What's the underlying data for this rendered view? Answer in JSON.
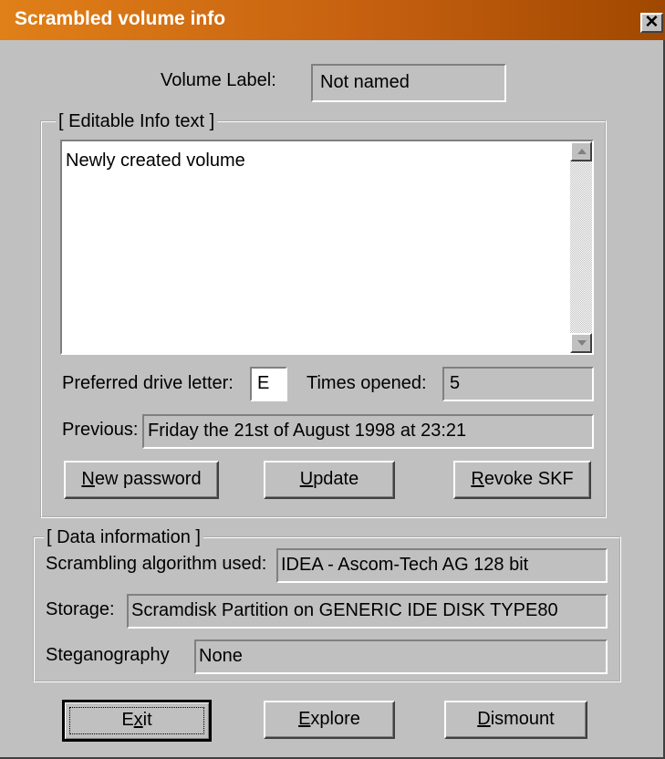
{
  "window": {
    "title": "Scrambled volume info",
    "close_label": "✕"
  },
  "volume_label": {
    "label": "Volume Label:",
    "value": "Not named"
  },
  "info_group": {
    "title": "[ Editable Info text ]",
    "memo_text": "Newly created volume",
    "preferred_drive_label": "Preferred drive letter:",
    "preferred_drive_value": "E",
    "times_opened_label": "Times opened:",
    "times_opened_value": "5",
    "previous_label": "Previous:",
    "previous_value": "Friday the 21st of August 1998 at 23:21",
    "buttons": {
      "new_password": {
        "key": "N",
        "rest": "ew password"
      },
      "update": {
        "key": "U",
        "rest": "pdate"
      },
      "revoke": {
        "key": "R",
        "rest": "evoke SKF"
      }
    }
  },
  "data_group": {
    "title": "[ Data information ]",
    "algorithm_label": "Scrambling algorithm used:",
    "algorithm_value": "IDEA - Ascom-Tech AG 128 bit",
    "storage_label": "Storage:",
    "storage_value": "Scramdisk Partition on GENERIC IDE  DISK TYPE80",
    "steganography_label": "Steganography",
    "steganography_value": "None"
  },
  "bottom_buttons": {
    "exit": {
      "pre": "E",
      "key": "x",
      "rest": "it"
    },
    "explore": {
      "key": "E",
      "rest": "xplore"
    },
    "dismount": {
      "key": "D",
      "rest": "ismount"
    }
  },
  "icons": {
    "close": "close-icon",
    "scroll_up": "arrow-up-icon",
    "scroll_down": "arrow-down-icon"
  },
  "colors": {
    "title_gradient_start": "#e08018",
    "title_gradient_end": "#a04800",
    "face": "#c0c0c0"
  }
}
